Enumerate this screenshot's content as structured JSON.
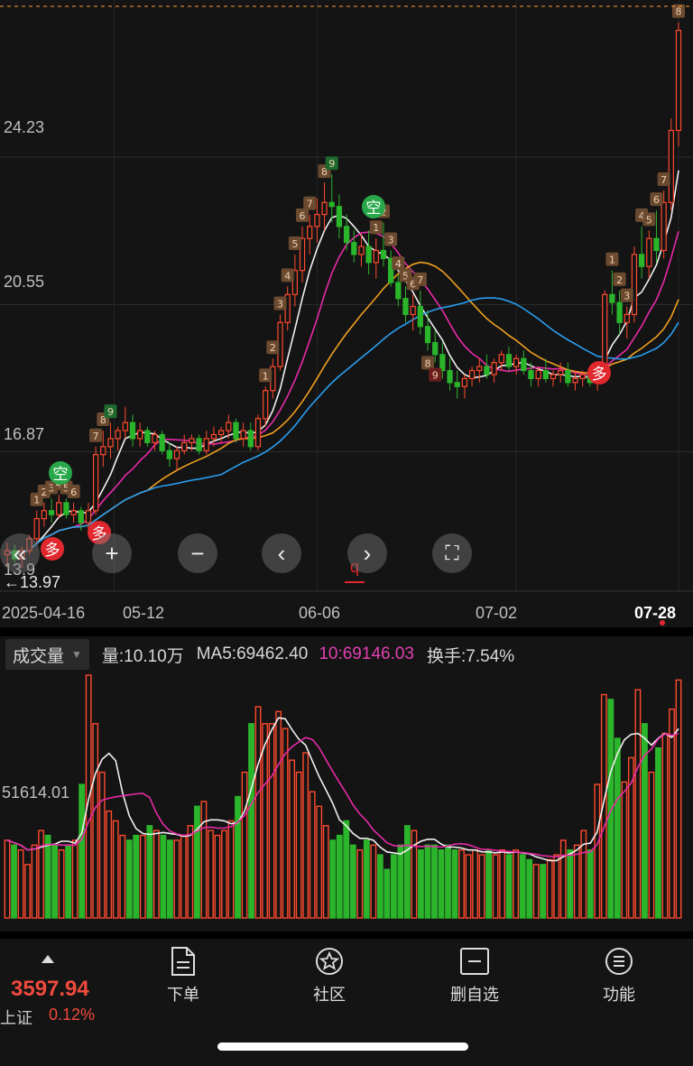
{
  "price_axis": {
    "labels": [
      "24.23",
      "20.55",
      "16.87"
    ],
    "low_marker": "←13.97",
    "low_label_partial": "13.9"
  },
  "date_axis": {
    "labels": [
      "2025-04-16",
      "05-12",
      "06-06",
      "07-02",
      "07-28"
    ],
    "event_marker": "q"
  },
  "signals": {
    "short": "空",
    "long": "多"
  },
  "controls": {
    "rewind": "«",
    "zoom_in": "+",
    "zoom_out": "−",
    "prev": "‹",
    "next": "›",
    "fullscreen": "⛶"
  },
  "volume_header": {
    "indicator": "成交量",
    "volume": "量:10.10万",
    "ma5": "MA5:69462.40",
    "ma10": "10:69146.03",
    "turnover": "换手:7.54%"
  },
  "volume_axis": {
    "level_label": "51614.01"
  },
  "bottom_bar": {
    "index_value": "3597.94",
    "index_name": "上证",
    "index_change": "0.12%",
    "tools": [
      "下单",
      "社区",
      "删自选",
      "功能"
    ]
  },
  "colors": {
    "up": "#ff4a2e",
    "down": "#2bb52b",
    "ma_white": "#f0f0f0",
    "ma_pink": "#e82aa8",
    "ma_orange": "#f0a020",
    "ma_blue": "#2a9ef0",
    "signal_green": "#28a84a",
    "signal_red": "#e0282e"
  },
  "chart_data": {
    "type": "candlestick",
    "y_range": [
      13.5,
      28.0
    ],
    "candles": [
      [
        14.3,
        14.6,
        14.0,
        14.4
      ],
      [
        14.4,
        14.55,
        14.1,
        14.2
      ],
      [
        14.2,
        14.5,
        13.97,
        14.4
      ],
      [
        14.4,
        14.8,
        14.3,
        14.7
      ],
      [
        14.7,
        15.4,
        14.6,
        15.2
      ],
      [
        15.2,
        15.6,
        15.0,
        15.4
      ],
      [
        15.4,
        15.7,
        15.1,
        15.3
      ],
      [
        15.3,
        15.8,
        15.2,
        15.6
      ],
      [
        15.6,
        15.7,
        15.2,
        15.3
      ],
      [
        15.3,
        15.6,
        15.1,
        15.4
      ],
      [
        15.4,
        15.5,
        14.9,
        15.1
      ],
      [
        15.1,
        15.6,
        14.9,
        15.4
      ],
      [
        15.4,
        17.0,
        15.3,
        16.8
      ],
      [
        16.8,
        17.4,
        16.5,
        17.0
      ],
      [
        17.0,
        17.6,
        16.7,
        17.2
      ],
      [
        17.2,
        17.5,
        16.9,
        17.4
      ],
      [
        17.4,
        18.0,
        17.2,
        17.6
      ],
      [
        17.6,
        17.8,
        17.0,
        17.2
      ],
      [
        17.2,
        17.6,
        17.0,
        17.4
      ],
      [
        17.4,
        17.5,
        17.0,
        17.1
      ],
      [
        17.1,
        17.4,
        16.9,
        17.3
      ],
      [
        17.3,
        17.4,
        16.8,
        16.9
      ],
      [
        16.9,
        17.1,
        16.5,
        16.7
      ],
      [
        16.7,
        17.0,
        16.4,
        16.9
      ],
      [
        16.9,
        17.3,
        16.8,
        17.1
      ],
      [
        17.1,
        17.3,
        16.9,
        17.2
      ],
      [
        17.2,
        17.3,
        16.8,
        16.9
      ],
      [
        16.9,
        17.4,
        16.8,
        17.2
      ],
      [
        17.2,
        17.5,
        17.0,
        17.3
      ],
      [
        17.3,
        17.5,
        17.1,
        17.4
      ],
      [
        17.4,
        17.8,
        17.2,
        17.6
      ],
      [
        17.6,
        17.7,
        17.1,
        17.2
      ],
      [
        17.2,
        17.6,
        17.0,
        17.4
      ],
      [
        17.4,
        17.6,
        16.9,
        17.0
      ],
      [
        17.0,
        17.8,
        16.9,
        17.7
      ],
      [
        17.7,
        18.5,
        17.5,
        18.4
      ],
      [
        18.4,
        19.2,
        18.2,
        19.0
      ],
      [
        19.0,
        20.3,
        18.9,
        20.1
      ],
      [
        20.1,
        21.0,
        19.9,
        20.8
      ],
      [
        20.8,
        21.8,
        20.5,
        21.4
      ],
      [
        21.4,
        22.5,
        21.1,
        22.2
      ],
      [
        22.2,
        22.8,
        21.8,
        22.5
      ],
      [
        22.5,
        23.2,
        22.1,
        22.8
      ],
      [
        22.8,
        23.6,
        22.4,
        23.1
      ],
      [
        23.1,
        23.8,
        22.6,
        23.0
      ],
      [
        23.0,
        23.3,
        22.2,
        22.5
      ],
      [
        22.5,
        22.8,
        21.9,
        22.1
      ],
      [
        22.1,
        22.4,
        21.6,
        21.8
      ],
      [
        21.8,
        22.3,
        21.5,
        22.0
      ],
      [
        22.0,
        22.4,
        21.3,
        21.6
      ],
      [
        21.6,
        22.2,
        21.2,
        21.9
      ],
      [
        21.9,
        22.6,
        21.5,
        21.7
      ],
      [
        21.7,
        21.9,
        21.0,
        21.1
      ],
      [
        21.1,
        21.3,
        20.5,
        20.7
      ],
      [
        20.7,
        21.0,
        20.1,
        20.3
      ],
      [
        20.3,
        20.8,
        19.9,
        20.5
      ],
      [
        20.5,
        20.9,
        19.8,
        20.0
      ],
      [
        20.0,
        20.4,
        19.4,
        19.6
      ],
      [
        19.6,
        19.9,
        19.1,
        19.3
      ],
      [
        19.3,
        19.6,
        18.7,
        18.9
      ],
      [
        18.9,
        19.2,
        18.4,
        18.6
      ],
      [
        18.6,
        18.9,
        18.2,
        18.5
      ],
      [
        18.5,
        18.8,
        18.2,
        18.7
      ],
      [
        18.7,
        19.0,
        18.5,
        18.9
      ],
      [
        18.9,
        19.2,
        18.6,
        19.0
      ],
      [
        19.0,
        19.3,
        18.7,
        18.8
      ],
      [
        18.8,
        19.2,
        18.6,
        19.1
      ],
      [
        19.1,
        19.4,
        18.9,
        19.3
      ],
      [
        19.3,
        19.5,
        18.9,
        19.0
      ],
      [
        19.0,
        19.3,
        18.8,
        19.2
      ],
      [
        19.2,
        19.4,
        18.8,
        18.9
      ],
      [
        18.9,
        19.1,
        18.5,
        18.7
      ],
      [
        18.7,
        19.0,
        18.5,
        18.9
      ],
      [
        18.9,
        19.2,
        18.6,
        18.7
      ],
      [
        18.7,
        18.9,
        18.5,
        18.8
      ],
      [
        18.8,
        19.1,
        18.6,
        18.9
      ],
      [
        18.9,
        19.1,
        18.5,
        18.6
      ],
      [
        18.6,
        18.9,
        18.4,
        18.7
      ],
      [
        18.7,
        18.9,
        18.5,
        18.8
      ],
      [
        18.8,
        19.0,
        18.5,
        18.6
      ],
      [
        18.6,
        19.0,
        18.4,
        18.9
      ],
      [
        18.9,
        20.9,
        18.8,
        20.8
      ],
      [
        20.8,
        21.4,
        20.3,
        20.6
      ],
      [
        20.6,
        20.9,
        19.8,
        20.1
      ],
      [
        20.1,
        20.5,
        19.7,
        20.3
      ],
      [
        20.3,
        22.0,
        20.1,
        21.8
      ],
      [
        21.8,
        22.5,
        21.2,
        21.5
      ],
      [
        21.5,
        22.4,
        21.2,
        22.2
      ],
      [
        22.2,
        22.9,
        21.6,
        21.9
      ],
      [
        21.9,
        23.4,
        21.7,
        23.1
      ],
      [
        23.1,
        25.2,
        22.9,
        24.9
      ],
      [
        24.9,
        27.6,
        24.5,
        27.4
      ]
    ],
    "volume": [
      0.32,
      0.3,
      0.28,
      0.22,
      0.3,
      0.36,
      0.34,
      0.3,
      0.28,
      0.3,
      0.32,
      0.55,
      1.0,
      0.8,
      0.6,
      0.44,
      0.4,
      0.34,
      0.32,
      0.34,
      0.34,
      0.38,
      0.36,
      0.34,
      0.32,
      0.32,
      0.34,
      0.38,
      0.46,
      0.48,
      0.36,
      0.34,
      0.36,
      0.4,
      0.5,
      0.6,
      0.8,
      0.87,
      0.8,
      0.8,
      0.85,
      0.78,
      0.65,
      0.6,
      0.68,
      0.52,
      0.46,
      0.38,
      0.32,
      0.34,
      0.4,
      0.3,
      0.28,
      0.32,
      0.3,
      0.26,
      0.2,
      0.26,
      0.3,
      0.38,
      0.36,
      0.28,
      0.3,
      0.3,
      0.28,
      0.3,
      0.28,
      0.28,
      0.26,
      0.28,
      0.26,
      0.28,
      0.26,
      0.28,
      0.26,
      0.28,
      0.26,
      0.24,
      0.22,
      0.22,
      0.24,
      0.26,
      0.32,
      0.28,
      0.3,
      0.36,
      0.28,
      0.55,
      0.92,
      0.9,
      0.74,
      0.56,
      0.66,
      0.94,
      0.8,
      0.6,
      0.7,
      0.76,
      0.86,
      0.98
    ]
  }
}
